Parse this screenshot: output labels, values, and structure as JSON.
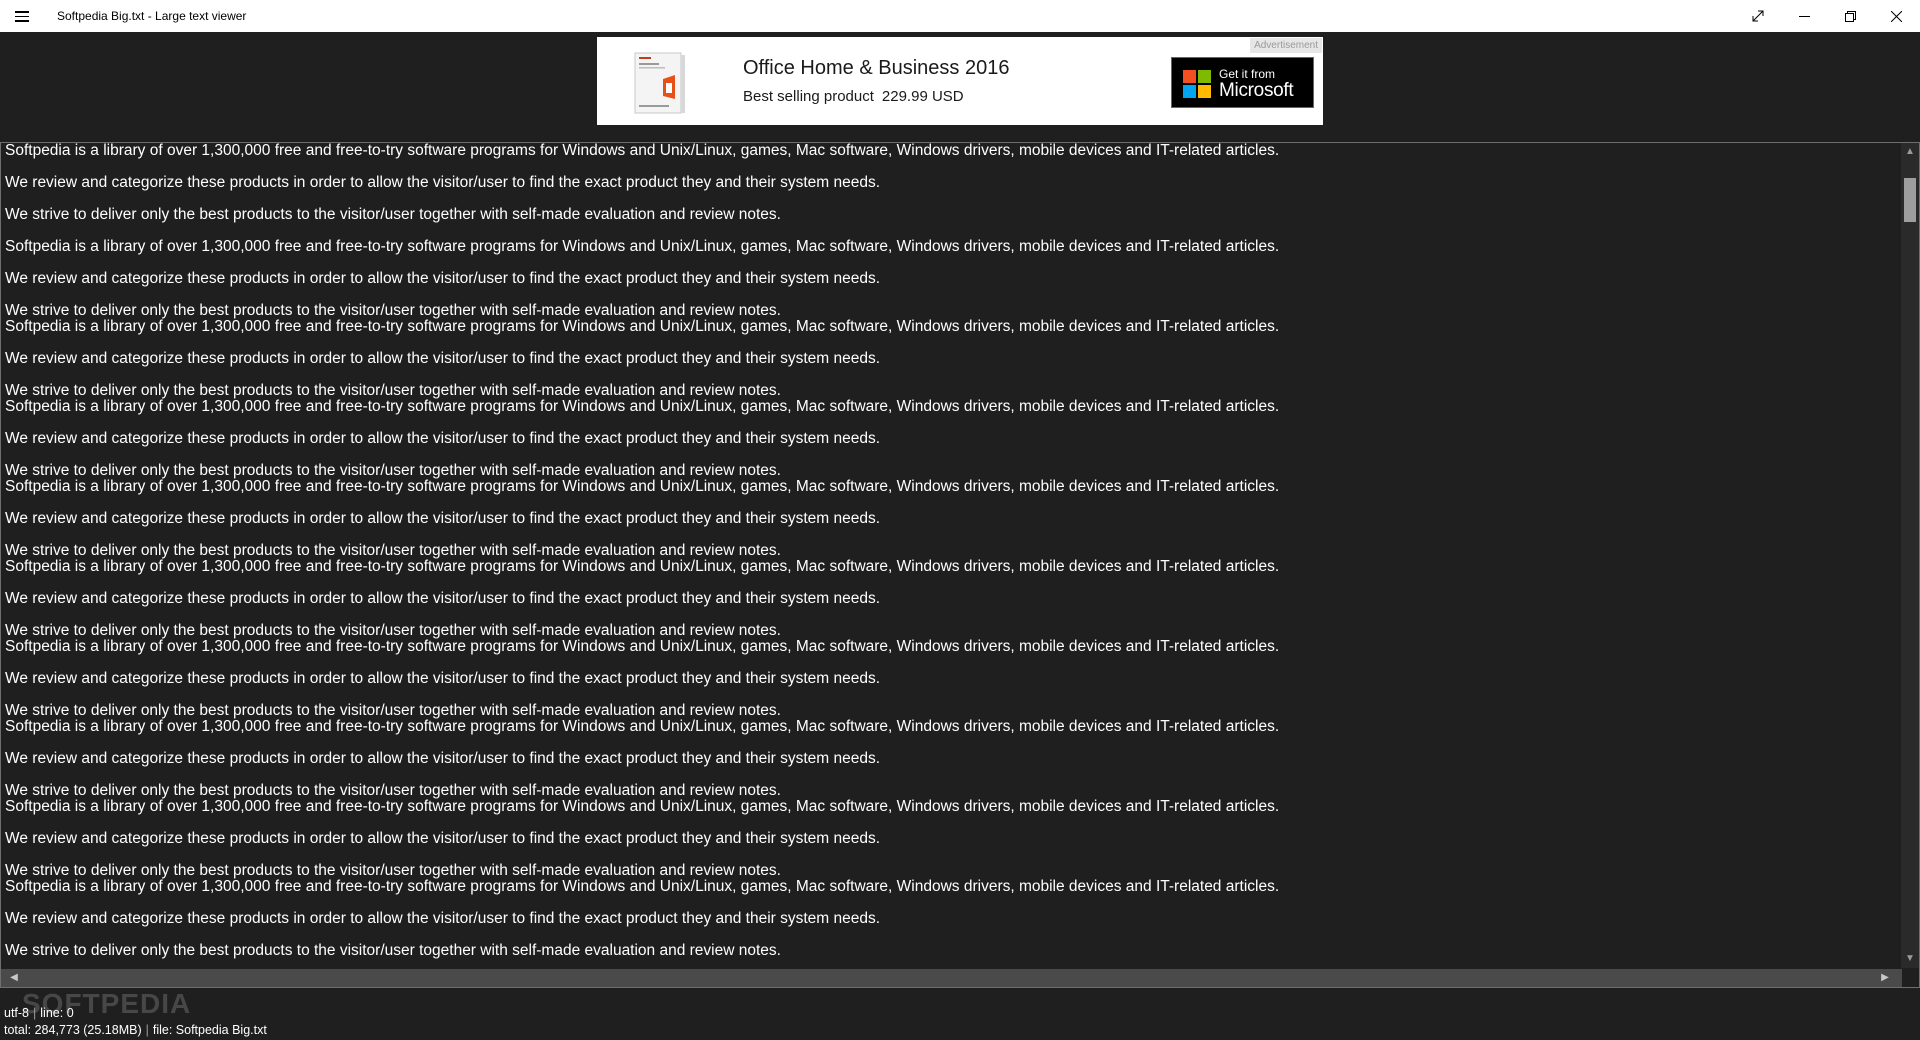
{
  "window": {
    "title": "Softpedia Big.txt - Large text viewer"
  },
  "ad": {
    "badge": "Advertisement",
    "title": "Office Home & Business 2016",
    "subtitle": "Best selling product",
    "price": "229.99 USD",
    "store_line1": "Get it from",
    "store_line2": "Microsoft",
    "logo_colors": [
      "#f25022",
      "#7fba00",
      "#00a4ef",
      "#ffb900"
    ]
  },
  "content": {
    "lines": [
      "Softpedia is a library of over 1,300,000 free and free-to-try software programs for Windows and Unix/Linux, games, Mac software, Windows drivers, mobile devices and IT-related articles.",
      "",
      "We review and categorize these products in order to allow the visitor/user to find the exact product they and their system needs.",
      "",
      "We strive to deliver only the best products to the visitor/user together with self-made evaluation and review notes.",
      "",
      "Softpedia is a library of over 1,300,000 free and free-to-try software programs for Windows and Unix/Linux, games, Mac software, Windows drivers, mobile devices and IT-related articles.",
      "",
      "We review and categorize these products in order to allow the visitor/user to find the exact product they and their system needs.",
      "",
      "We strive to deliver only the best products to the visitor/user together with self-made evaluation and review notes.",
      "Softpedia is a library of over 1,300,000 free and free-to-try software programs for Windows and Unix/Linux, games, Mac software, Windows drivers, mobile devices and IT-related articles.",
      "",
      "We review and categorize these products in order to allow the visitor/user to find the exact product they and their system needs.",
      "",
      "We strive to deliver only the best products to the visitor/user together with self-made evaluation and review notes.",
      "Softpedia is a library of over 1,300,000 free and free-to-try software programs for Windows and Unix/Linux, games, Mac software, Windows drivers, mobile devices and IT-related articles.",
      "",
      "We review and categorize these products in order to allow the visitor/user to find the exact product they and their system needs.",
      "",
      "We strive to deliver only the best products to the visitor/user together with self-made evaluation and review notes.",
      "Softpedia is a library of over 1,300,000 free and free-to-try software programs for Windows and Unix/Linux, games, Mac software, Windows drivers, mobile devices and IT-related articles.",
      "",
      "We review and categorize these products in order to allow the visitor/user to find the exact product they and their system needs.",
      "",
      "We strive to deliver only the best products to the visitor/user together with self-made evaluation and review notes.",
      "Softpedia is a library of over 1,300,000 free and free-to-try software programs for Windows and Unix/Linux, games, Mac software, Windows drivers, mobile devices and IT-related articles.",
      "",
      "We review and categorize these products in order to allow the visitor/user to find the exact product they and their system needs.",
      "",
      "We strive to deliver only the best products to the visitor/user together with self-made evaluation and review notes.",
      "Softpedia is a library of over 1,300,000 free and free-to-try software programs for Windows and Unix/Linux, games, Mac software, Windows drivers, mobile devices and IT-related articles.",
      "",
      "We review and categorize these products in order to allow the visitor/user to find the exact product they and their system needs.",
      "",
      "We strive to deliver only the best products to the visitor/user together with self-made evaluation and review notes.",
      "Softpedia is a library of over 1,300,000 free and free-to-try software programs for Windows and Unix/Linux, games, Mac software, Windows drivers, mobile devices and IT-related articles.",
      "",
      "We review and categorize these products in order to allow the visitor/user to find the exact product they and their system needs.",
      "",
      "We strive to deliver only the best products to the visitor/user together with self-made evaluation and review notes.",
      "Softpedia is a library of over 1,300,000 free and free-to-try software programs for Windows and Unix/Linux, games, Mac software, Windows drivers, mobile devices and IT-related articles.",
      "",
      "We review and categorize these products in order to allow the visitor/user to find the exact product they and their system needs.",
      "",
      "We strive to deliver only the best products to the visitor/user together with self-made evaluation and review notes.",
      "Softpedia is a library of over 1,300,000 free and free-to-try software programs for Windows and Unix/Linux, games, Mac software, Windows drivers, mobile devices and IT-related articles.",
      "",
      "We review and categorize these products in order to allow the visitor/user to find the exact product they and their system needs.",
      "",
      "We strive to deliver only the best products to the visitor/user together with self-made evaluation and review notes."
    ]
  },
  "status": {
    "encoding": "utf-8",
    "line_label": "line:",
    "line_value": "0",
    "total_label": "total:",
    "total_value": "284,773 (25.18MB)",
    "file_label": "file:",
    "file_value": "Softpedia Big.txt"
  },
  "watermark": "SOFTPEDIA"
}
